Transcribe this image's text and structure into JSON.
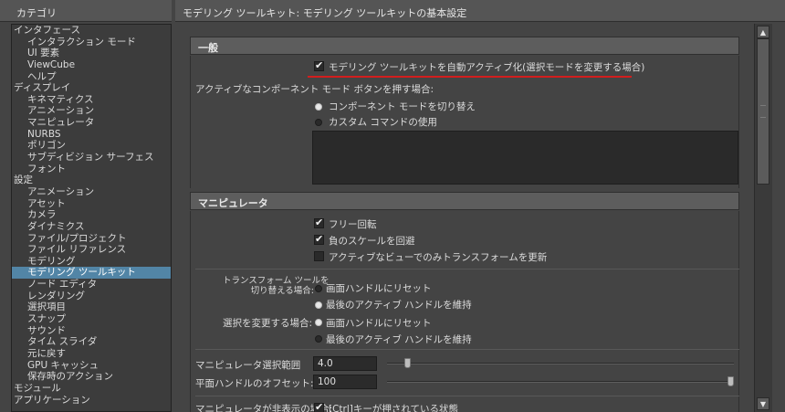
{
  "header": {
    "left_title": "カテゴリ",
    "right_title": "モデリング ツールキット: モデリング ツールキットの基本設定"
  },
  "categories": [
    {
      "label": "インタフェース",
      "level": 0
    },
    {
      "label": "インタラクション モード",
      "level": 1
    },
    {
      "label": "UI 要素",
      "level": 1
    },
    {
      "label": "ViewCube",
      "level": 1
    },
    {
      "label": "ヘルプ",
      "level": 1
    },
    {
      "label": "ディスプレイ",
      "level": 0
    },
    {
      "label": "キネマティクス",
      "level": 1
    },
    {
      "label": "アニメーション",
      "level": 1
    },
    {
      "label": "マニピュレータ",
      "level": 1
    },
    {
      "label": "NURBS",
      "level": 1
    },
    {
      "label": "ポリゴン",
      "level": 1
    },
    {
      "label": "サブディビジョン サーフェス",
      "level": 1
    },
    {
      "label": "フォント",
      "level": 1
    },
    {
      "label": "設定",
      "level": 0
    },
    {
      "label": "アニメーション",
      "level": 1
    },
    {
      "label": "アセット",
      "level": 1
    },
    {
      "label": "カメラ",
      "level": 1
    },
    {
      "label": "ダイナミクス",
      "level": 1
    },
    {
      "label": "ファイル/プロジェクト",
      "level": 1
    },
    {
      "label": "ファイル リファレンス",
      "level": 1
    },
    {
      "label": "モデリング",
      "level": 1
    },
    {
      "label": "モデリング ツールキット",
      "level": 1,
      "selected": true
    },
    {
      "label": "ノード エディタ",
      "level": 1
    },
    {
      "label": "レンダリング",
      "level": 1
    },
    {
      "label": "選択項目",
      "level": 1
    },
    {
      "label": "スナップ",
      "level": 1
    },
    {
      "label": "サウンド",
      "level": 1
    },
    {
      "label": "タイム スライダ",
      "level": 1
    },
    {
      "label": "元に戻す",
      "level": 1
    },
    {
      "label": "GPU キャッシュ",
      "level": 1
    },
    {
      "label": "保存時のアクション",
      "level": 1
    },
    {
      "label": "モジュール",
      "level": 0
    },
    {
      "label": "アプリケーション",
      "level": 0
    }
  ],
  "general": {
    "title": "一般",
    "auto_activate": {
      "label": "モデリング ツールキットを自動アクティブ化(選択モードを変更する場合)",
      "checked": true
    },
    "component_prompt": "アクティブなコンポーネント モード ボタンを押す場合:",
    "radio_toggle": {
      "label": "コンポーネント モードを切り替え",
      "checked": true
    },
    "radio_custom": {
      "label": "カスタム コマンドの使用",
      "checked": false
    }
  },
  "manipulator": {
    "title": "マニピュレータ",
    "free_rotate": {
      "label": "フリー回転",
      "checked": true
    },
    "avoid_negative": {
      "label": "負のスケールを回避",
      "checked": true
    },
    "active_view_only": {
      "label": "アクティブなビューでのみトランスフォームを更新",
      "checked": false
    },
    "switch_transform_label_line1": "トランスフォーム ツールを",
    "switch_transform_label_line2": "切り替える場合:",
    "switch_reset": {
      "label": "画面ハンドルにリセット",
      "checked": false
    },
    "switch_keep": {
      "label": "最後のアクティブ ハンドルを維持",
      "checked": true
    },
    "change_selection_label": "選択を変更する場合:",
    "sel_reset": {
      "label": "画面ハンドルにリセット",
      "checked": true
    },
    "sel_keep": {
      "label": "最後のアクティブ ハンドルを維持",
      "checked": false
    },
    "range_label": "マニピュレータ選択範囲",
    "range_value": "4.0",
    "range_fraction": 0.05,
    "offset_label": "平面ハンドルのオフセット:",
    "offset_value": "100",
    "offset_fraction": 1.0,
    "hidden_label": "マニピュレータが非表示の場合:",
    "hidden_option": {
      "label": "[Ctrl]キーが押されている状態",
      "checked": true
    }
  },
  "scrollbar": {
    "up_icon": "triangle-up",
    "down_icon": "triangle-down"
  },
  "colors": {
    "selection": "#5285a6",
    "highlight_line": "#d21d1d"
  }
}
